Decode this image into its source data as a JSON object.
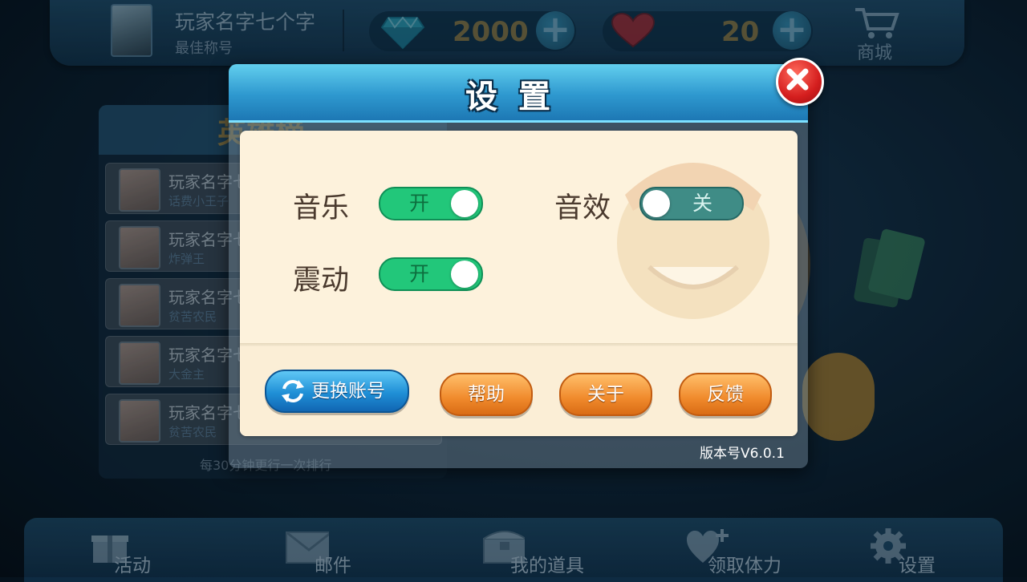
{
  "header": {
    "player_name": "玩家名字七个字",
    "player_title": "最佳称号",
    "diamonds": "2000",
    "hearts": "20",
    "shop_label": "商城"
  },
  "leaderboard": {
    "title": "英雄榜",
    "rows": [
      {
        "name": "玩家名字七",
        "title": "话费小王子"
      },
      {
        "name": "玩家名字七",
        "title": "炸弹王"
      },
      {
        "name": "玩家名字七",
        "title": "贫苦农民"
      },
      {
        "name": "玩家名字七",
        "title": "大金主"
      },
      {
        "name": "玩家名字七",
        "title": "贫苦农民"
      }
    ],
    "footer": "每30分钟更行一次排行"
  },
  "bottom_nav": [
    {
      "label": "活动",
      "icon": "gift-icon"
    },
    {
      "label": "邮件",
      "icon": "mail-icon"
    },
    {
      "label": "我的道具",
      "icon": "chest-icon"
    },
    {
      "label": "领取体力",
      "icon": "heart-plus-icon"
    },
    {
      "label": "设置",
      "icon": "gear-icon"
    }
  ],
  "dialog": {
    "title": "设置",
    "settings": {
      "music": {
        "label": "音乐",
        "state": "开",
        "on": true
      },
      "sound_fx": {
        "label": "音效",
        "state": "关",
        "on": false
      },
      "vibration": {
        "label": "震动",
        "state": "开",
        "on": true
      }
    },
    "buttons": {
      "switch_account": "更换账号",
      "help": "帮助",
      "about": "关于",
      "feedback": "反馈"
    },
    "version": "版本号V6.0.1"
  },
  "colors": {
    "toggle_on": "#22c77a",
    "toggle_off": "#3f8c86",
    "orange_button": "#f08a2c",
    "blue_button": "#1f8fd6",
    "dialog_header": "#2e98cf",
    "close_button": "#d41e1e"
  }
}
